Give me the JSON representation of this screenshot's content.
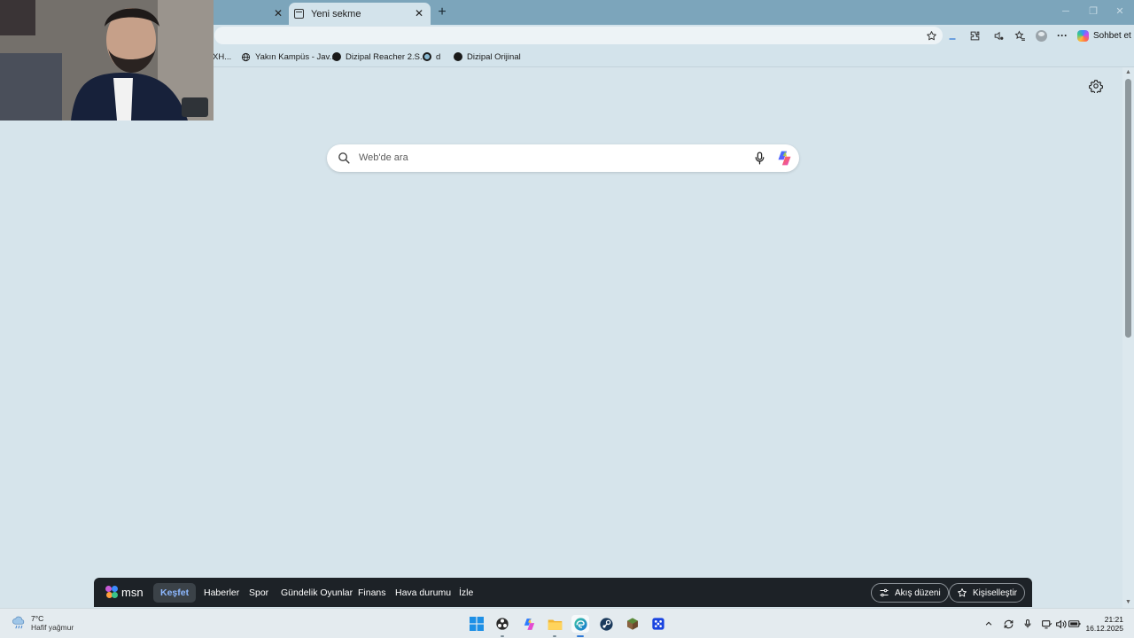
{
  "browser": {
    "tabs": [
      {
        "title": "",
        "active": false
      },
      {
        "title": "Yeni sekme",
        "active": true
      }
    ],
    "new_tab_icon": "plus-icon",
    "window_controls": [
      "minimize-icon",
      "restore-icon",
      "close-icon"
    ],
    "toolbar": {
      "icons": [
        "favorite-star-icon",
        "download-icon",
        "extensions-icon",
        "read-aloud-icon",
        "favorites-icon",
        "profile-icon",
        "more-icon"
      ],
      "more_label": "···",
      "chat_label": "Sohbet et"
    },
    "favorites": [
      {
        "label": "XH...",
        "icon": "none"
      },
      {
        "label": "Yakın Kampüs - Jav...",
        "icon": "globe-icon"
      },
      {
        "label": "Dizipal Reacher 2.S...",
        "icon": "dark-dot-icon"
      },
      {
        "label": "d",
        "icon": "ring-icon"
      },
      {
        "label": "Dizipal Orijinal",
        "icon": "dark-dot-icon"
      }
    ]
  },
  "newtab": {
    "search": {
      "placeholder": "Web'de ara"
    },
    "settings_icon": "gear-icon"
  },
  "msn": {
    "logo_text": "msn",
    "nav": [
      {
        "label": "Keşfet",
        "active": true
      },
      {
        "label": "Haberler",
        "active": false
      },
      {
        "label": "Spor",
        "active": false
      },
      {
        "label": "Gündelik Oyunlar",
        "active": false
      },
      {
        "label": "Finans",
        "active": false
      },
      {
        "label": "Hava durumu",
        "active": false
      },
      {
        "label": "İzle",
        "active": false
      }
    ],
    "feed_layout_label": "Akış düzeni",
    "personalize_label": "Kişiselleştir"
  },
  "taskbar": {
    "weather": {
      "temp": "7°C",
      "desc": "Hafif yağmur"
    },
    "apps": [
      "windows-start-icon",
      "obs-icon",
      "copilot-icon",
      "file-explorer-icon",
      "edge-icon",
      "steam-icon",
      "minecraft-icon",
      "game-app-icon"
    ],
    "tray_icons": [
      "chevron-up-icon",
      "sync-icon",
      "microphone-icon",
      "network-icon",
      "volume-icon",
      "battery-icon"
    ],
    "time": "21:21",
    "date": "16.12.2025"
  },
  "colors": {
    "tab_strip": "#7ca5bb",
    "page_bg": "#d6e4eb",
    "msn_bar": "#1d2227",
    "msn_active": "#8db8ff"
  }
}
